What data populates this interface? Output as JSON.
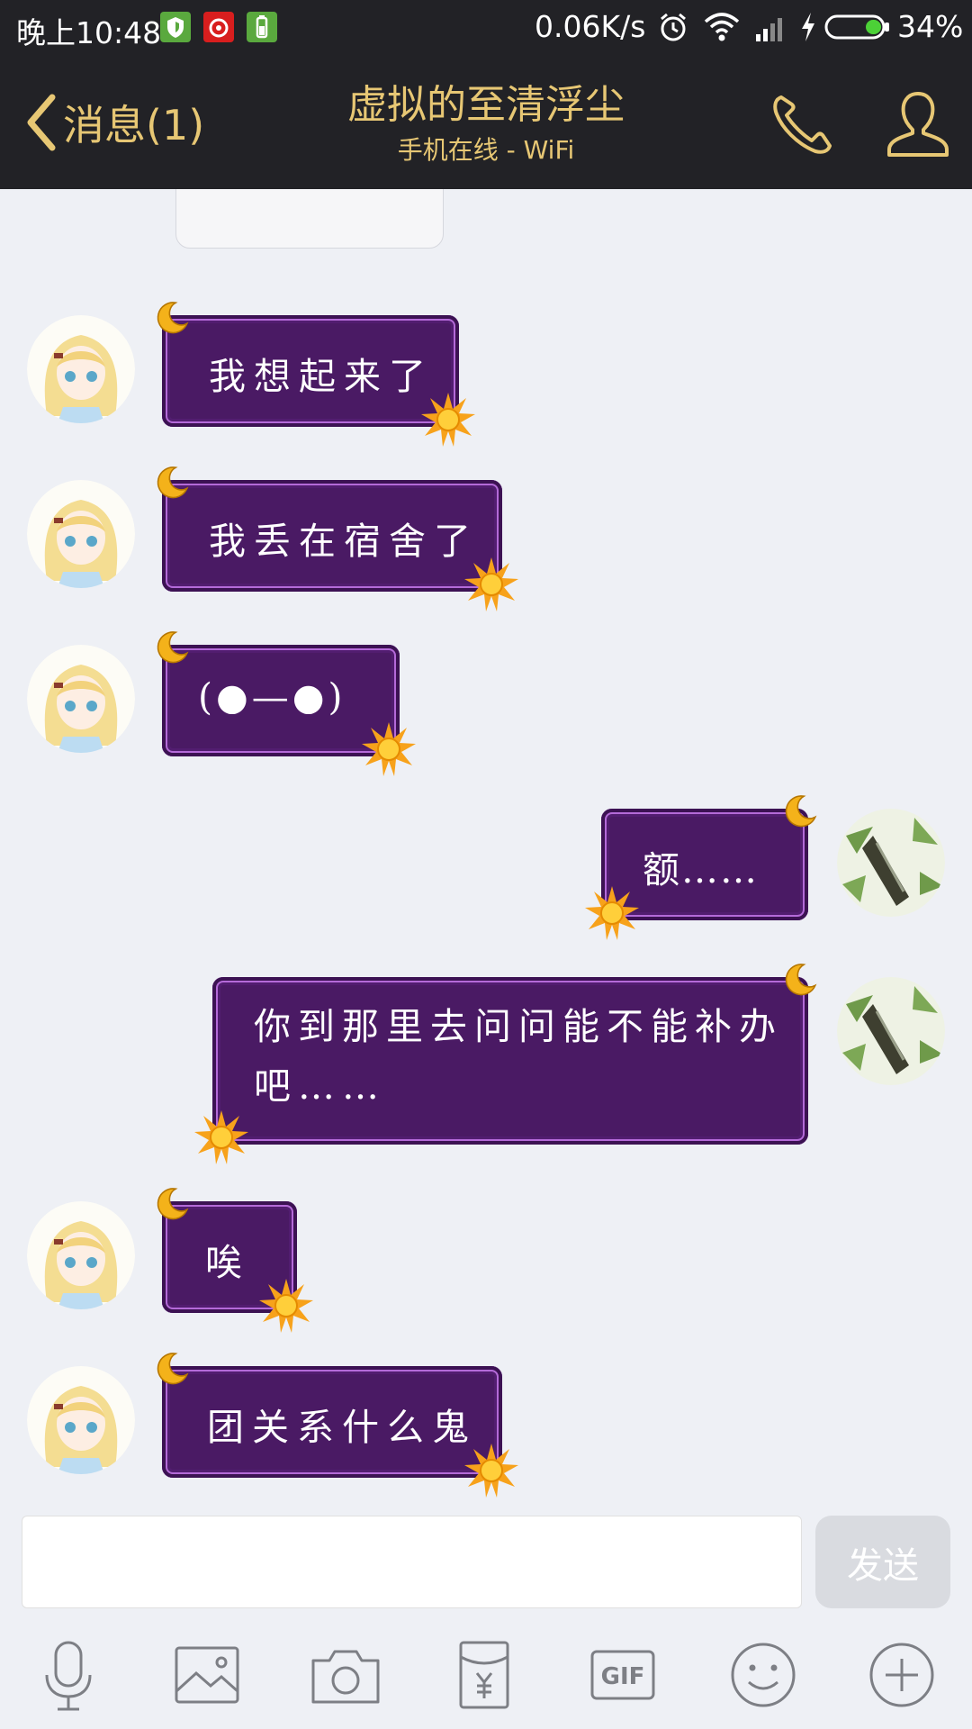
{
  "status_bar": {
    "time": "晚上10:48",
    "network_speed": "0.06K/s",
    "battery": "34%",
    "icons": [
      "shield-app-icon",
      "netease-music-icon",
      "battery-app-icon",
      "alarm-icon",
      "wifi-icon",
      "signal-icon",
      "charging-icon",
      "battery-icon"
    ]
  },
  "header": {
    "back_label": "消息(1)",
    "title": "虚拟的至清浮尘",
    "subtitle": "手机在线 - WiFi",
    "icons": [
      "back-chevron-icon",
      "phone-icon",
      "profile-icon"
    ]
  },
  "messages": [
    {
      "side": "left",
      "text": "我想起来了"
    },
    {
      "side": "left",
      "text": "我丢在宿舍了"
    },
    {
      "side": "left",
      "text": "(●—●)"
    },
    {
      "side": "right",
      "text": "额……"
    },
    {
      "side": "right",
      "text": "你到那里去问问能不能补办吧……"
    },
    {
      "side": "left",
      "text": "唉"
    },
    {
      "side": "left",
      "text": "团关系什么鬼"
    }
  ],
  "input": {
    "value": "",
    "send_label": "发送"
  },
  "toolbar": {
    "icons": [
      "microphone-icon",
      "image-icon",
      "camera-icon",
      "red-packet-icon",
      "gif-icon",
      "emoji-icon",
      "plus-icon"
    ]
  },
  "colors": {
    "header_bg": "#222226",
    "header_text": "#e7c774",
    "chat_bg": "#eef0f5",
    "bubble": "#4a1a64",
    "bubble_border": "#b46ad8",
    "send_disabled": "#d9dbe0"
  }
}
